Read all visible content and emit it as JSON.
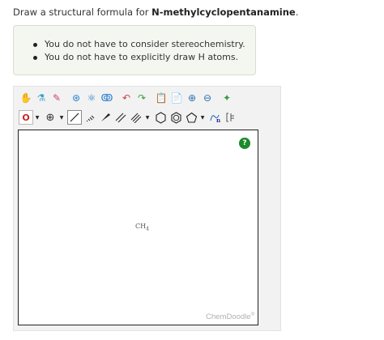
{
  "question": {
    "prefix": "Draw a structural formula for ",
    "compound": "N-methylcyclopentanamine",
    "suffix": "."
  },
  "hints": [
    "You do not have to consider stereochemistry.",
    "You do not have to explicitly draw H atoms."
  ],
  "sketcher": {
    "toolbar_row1": [
      {
        "name": "hand-icon",
        "glyph": "✋",
        "color": "#c87a2a"
      },
      {
        "name": "lasso-icon",
        "glyph": "⚗",
        "color": "#3aa0c8"
      },
      {
        "name": "eraser-icon",
        "glyph": "✎",
        "color": "#d0407a"
      },
      {
        "name": "center-icon",
        "glyph": "⊛",
        "color": "#2a7fd0"
      },
      {
        "name": "clean-icon",
        "glyph": "⚛",
        "color": "#2a7fd0"
      },
      {
        "name": "cleanup-3d-icon",
        "glyph": "ↂ",
        "color": "#2a7fd0"
      },
      {
        "name": "undo-icon",
        "glyph": "↶",
        "color": "#d04040"
      },
      {
        "name": "redo-icon",
        "glyph": "↷",
        "color": "#3aa040"
      },
      {
        "name": "paste-icon",
        "glyph": "📋",
        "color": "#c8a020"
      },
      {
        "name": "copy-icon",
        "glyph": "📄",
        "color": "#c8a020"
      },
      {
        "name": "zoom-in-icon",
        "glyph": "⊕",
        "color": "#2a6fb0"
      },
      {
        "name": "zoom-out-icon",
        "glyph": "⊖",
        "color": "#2a6fb0"
      },
      {
        "name": "erase-all-icon",
        "glyph": "✦",
        "color": "#3a9a4a"
      }
    ],
    "atom_label": "O",
    "charge_glyph": "⊕",
    "canvas_atom": "CH",
    "canvas_atom_sub": "4",
    "help_label": "?",
    "brand": "ChemDoodle",
    "brand_mark": "®"
  }
}
